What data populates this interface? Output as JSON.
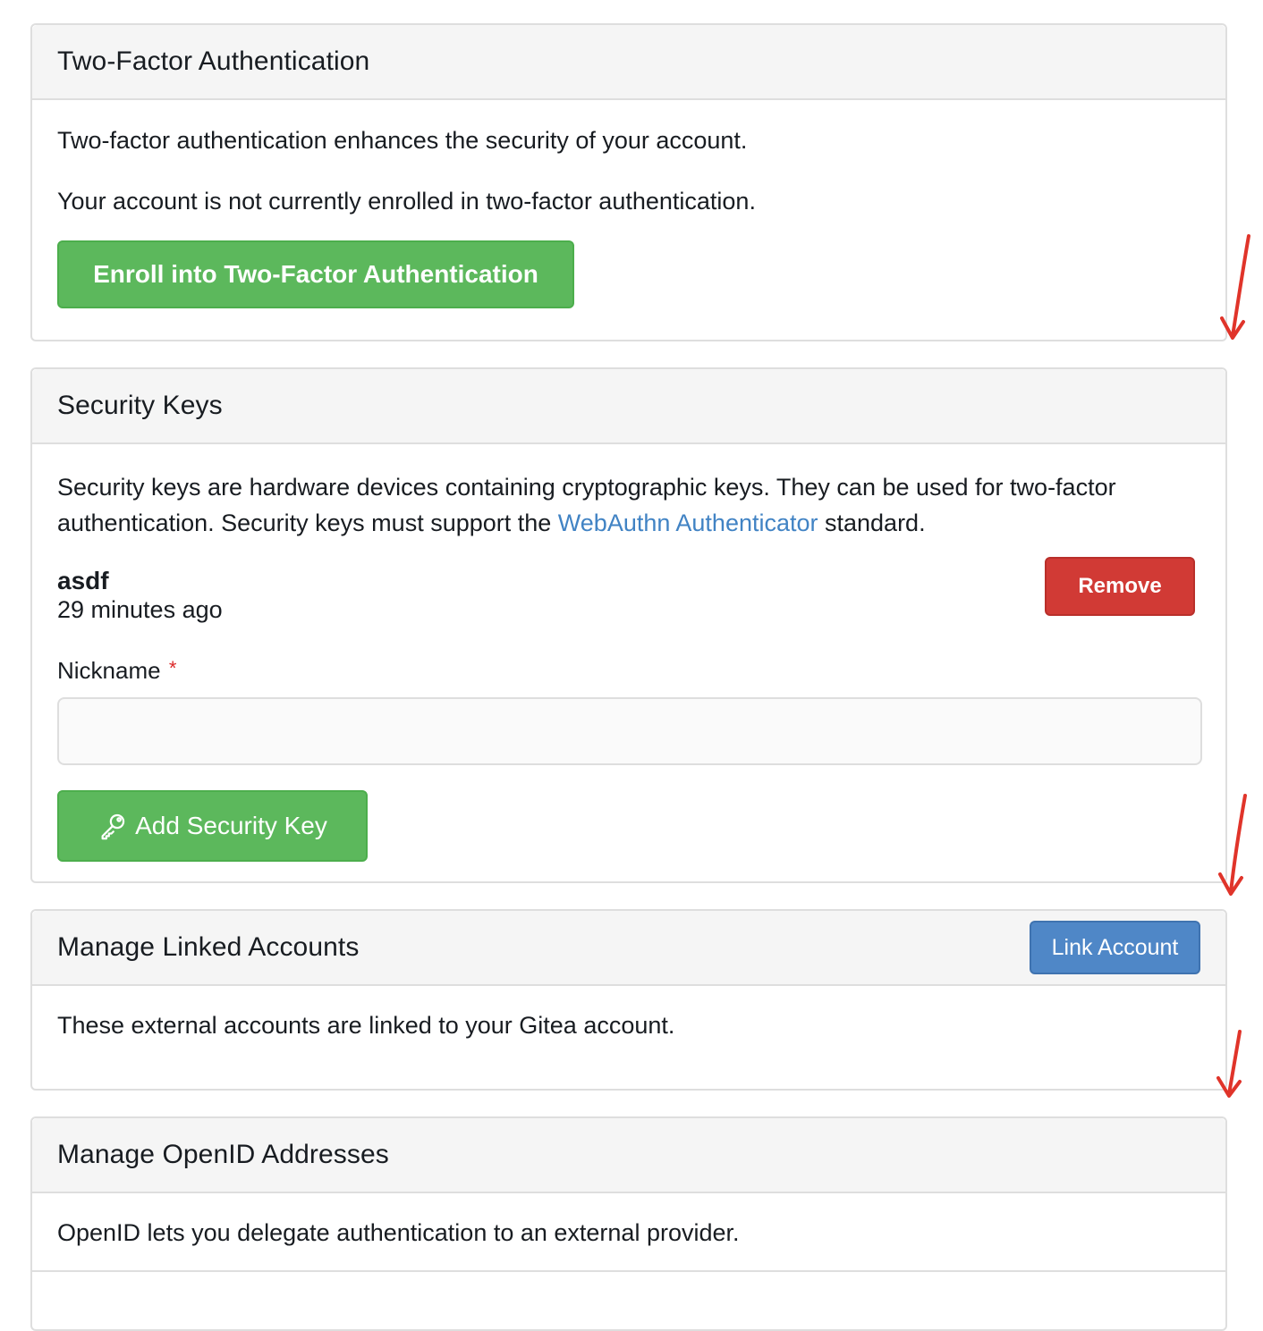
{
  "two_factor": {
    "title": "Two-Factor Authentication",
    "description": "Two-factor authentication enhances the security of your account.",
    "status": "Your account is not currently enrolled in two-factor authentication.",
    "enroll_label": "Enroll into Two-Factor Authentication"
  },
  "security_keys": {
    "title": "Security Keys",
    "description_before": "Security keys are hardware devices containing cryptographic keys. They can be used for two-factor authentication. Security keys must support the ",
    "link_label": "WebAuthn Authenticator",
    "description_after": " standard.",
    "keys": [
      {
        "name": "asdf",
        "time": "29 minutes ago",
        "remove_label": "Remove"
      }
    ],
    "nickname_label": "Nickname",
    "required_marker": "*",
    "nickname_value": "",
    "add_label": "Add Security Key",
    "add_icon": "key-icon"
  },
  "linked_accounts": {
    "title": "Manage Linked Accounts",
    "link_label": "Link Account",
    "description": "These external accounts are linked to your Gitea account."
  },
  "openid": {
    "title": "Manage OpenID Addresses",
    "description": "OpenID lets you delegate authentication to an external provider."
  },
  "annotations": {
    "arrow_color": "#e0342a"
  },
  "colors": {
    "success": "#5cb85c",
    "danger": "#d13a35",
    "primary": "#4f87c7",
    "link": "#4183c4"
  }
}
